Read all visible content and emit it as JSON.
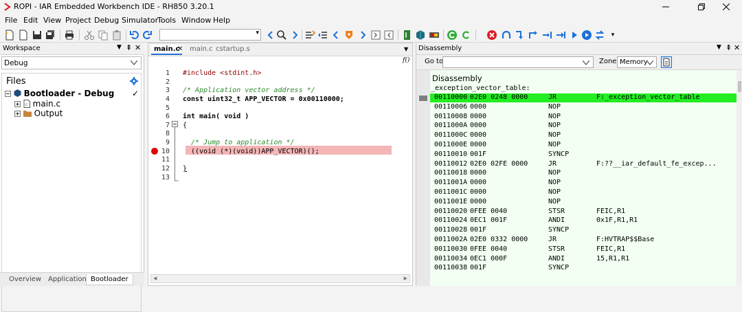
{
  "window": {
    "title": "ROPI - IAR Embedded Workbench IDE - RH850 3.20.1"
  },
  "menu": [
    "File",
    "Edit",
    "View",
    "Project",
    "Debug",
    "Simulator",
    "Tools",
    "Window",
    "Help"
  ],
  "workspace": {
    "title": "Workspace",
    "config": "Debug",
    "files_label": "Files",
    "project": "Bootloader - Debug",
    "items": [
      "main.c",
      "Output"
    ],
    "tabs": [
      "Overview",
      "Application",
      "Bootloader"
    ],
    "active_tab": "Bootloader"
  },
  "editor": {
    "tabs": [
      "main.c",
      "main.c",
      "cstartup.s"
    ],
    "func_icon": "f()",
    "lines": [
      {
        "n": "1",
        "t": "#include <stdint.h>"
      },
      {
        "n": "2",
        "t": ""
      },
      {
        "n": "3",
        "t": "/* Application vector address */"
      },
      {
        "n": "4",
        "t": "const uint32_t APP_VECTOR = 0x00110000;"
      },
      {
        "n": "5",
        "t": ""
      },
      {
        "n": "6",
        "t": "int main( void )"
      },
      {
        "n": "7",
        "t": "{"
      },
      {
        "n": "8",
        "t": ""
      },
      {
        "n": "9",
        "t": "  /* Jump to application */"
      },
      {
        "n": "10",
        "t": "  ((void (*)(void))APP_VECTOR)();"
      },
      {
        "n": "11",
        "t": ""
      },
      {
        "n": "12",
        "t": "}"
      },
      {
        "n": "13",
        "t": ""
      }
    ],
    "breakpoint_line": "10"
  },
  "disassembly": {
    "title": "Disassembly",
    "goto_label": "Go to:",
    "zone_label": "Zone:",
    "zone_value": "Memory",
    "section_title": "Disassembly",
    "label": "_exception_vector_table:",
    "rows": [
      {
        "addr": "00110000",
        "code": "02E0 0248 0000",
        "op": "JR",
        "arg": "F:_exception_vector_table"
      },
      {
        "addr": "00110006",
        "code": "0000",
        "op": "NOP",
        "arg": ""
      },
      {
        "addr": "00110008",
        "code": "0000",
        "op": "NOP",
        "arg": ""
      },
      {
        "addr": "0011000A",
        "code": "0000",
        "op": "NOP",
        "arg": ""
      },
      {
        "addr": "0011000C",
        "code": "0000",
        "op": "NOP",
        "arg": ""
      },
      {
        "addr": "0011000E",
        "code": "0000",
        "op": "NOP",
        "arg": ""
      },
      {
        "addr": "00110010",
        "code": "001F",
        "op": "SYNCP",
        "arg": ""
      },
      {
        "addr": "00110012",
        "code": "02E0 02FE 0000",
        "op": "JR",
        "arg": "F:??__iar_default_fe_excep..."
      },
      {
        "addr": "00110018",
        "code": "0000",
        "op": "NOP",
        "arg": ""
      },
      {
        "addr": "0011001A",
        "code": "0000",
        "op": "NOP",
        "arg": ""
      },
      {
        "addr": "0011001C",
        "code": "0000",
        "op": "NOP",
        "arg": ""
      },
      {
        "addr": "0011001E",
        "code": "0000",
        "op": "NOP",
        "arg": ""
      },
      {
        "addr": "00110020",
        "code": "0FEE 0040",
        "op": "STSR",
        "arg": "FEIC,R1"
      },
      {
        "addr": "00110024",
        "code": "0EC1 001F",
        "op": "ANDI",
        "arg": "0x1F,R1,R1"
      },
      {
        "addr": "00110028",
        "code": "001F",
        "op": "SYNCP",
        "arg": ""
      },
      {
        "addr": "0011002A",
        "code": "02E0 0332 0000",
        "op": "JR",
        "arg": "F:HVTRAP$$Base"
      },
      {
        "addr": "00110030",
        "code": "0FEE 0040",
        "op": "STSR",
        "arg": "FEIC,R1"
      },
      {
        "addr": "00110034",
        "code": "0EC1 000F",
        "op": "ANDI",
        "arg": "15,R1,R1"
      },
      {
        "addr": "00110038",
        "code": "001F",
        "op": "SYNCP",
        "arg": ""
      }
    ]
  },
  "colors": {
    "current_row": "#22ee22",
    "disasm_bg": "#f2fff2",
    "breakpoint": "#e00000",
    "bp_line": "#f4b6b6",
    "accent": "#1e6fd9"
  }
}
